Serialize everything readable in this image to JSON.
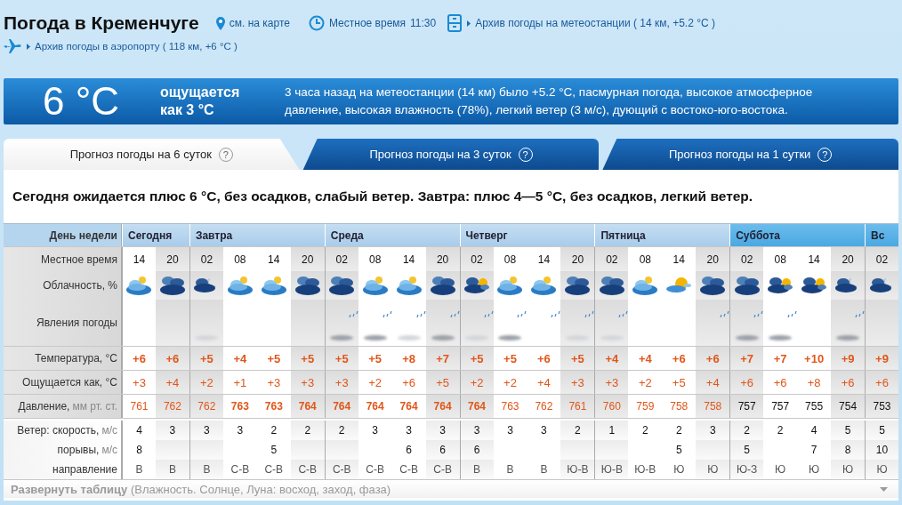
{
  "header": {
    "title": "Погода в Кременчуге",
    "map_link": "см. на карте",
    "local_time_label": "Местное время",
    "local_time": "11:30",
    "station_link": "Архив погоды на метеостанции ( 14 км, +5.2 °С )",
    "airport_link": "Архив погоды в аэропорту ( 118 км, +6 °С )"
  },
  "current": {
    "temperature": "6 °C",
    "feels_like": "ощущается как 3 °C",
    "description": "3 часа назад на метеостанции (14 км) было +5.2 °С, пасмурная погода, высокое атмосферное давление, высокая влажность (78%), легкий ветер (3 м/с), дующий с востоко-юго-востока."
  },
  "tabs": [
    {
      "label": "Прогноз погоды на 6 суток",
      "help": "?",
      "selected": true
    },
    {
      "label": "Прогноз погоды на 3 суток",
      "help": "?",
      "selected": false
    },
    {
      "label": "Прогноз погоды на 1 сутки",
      "help": "?",
      "selected": false
    }
  ],
  "summary": "Сегодня ожидается плюс 6 °С, без осадков, слабый ветер. Завтра: плюс 4—5 °С, без осадков, легкий ветер.",
  "row_labels": [
    {
      "text": "День недели"
    },
    {
      "text": "Местное время"
    },
    {
      "text": "Облачность, %"
    },
    {
      "text": "Явления погоды"
    },
    {
      "text": "Температура, °С"
    },
    {
      "text": "Ощущается как, °С"
    },
    {
      "text": "Давление,",
      "unit": "мм рт. ст."
    },
    {
      "text": "Ветер: скорость,",
      "unit": "м/с"
    },
    {
      "text": "порывы,",
      "unit": "м/с"
    },
    {
      "text": "направление"
    }
  ],
  "days": [
    {
      "name": "Сегодня",
      "weekend": false,
      "columns": [
        {
          "time": "14",
          "night": false,
          "sky": {
            "kind": "cloudy"
          },
          "temp": "+6",
          "feels": "+3",
          "pressure": {
            "text": "761",
            "kind": "elevated"
          },
          "wind": "4",
          "gusts": "8",
          "direction": "В"
        },
        {
          "time": "20",
          "night": true,
          "sky": {
            "kind": "overcast"
          },
          "temp": "+6",
          "feels": "+4",
          "pressure": {
            "text": "762",
            "kind": "elevated"
          },
          "wind": "3",
          "direction": "В"
        }
      ]
    },
    {
      "name": "Завтра",
      "weekend": false,
      "columns": [
        {
          "time": "02",
          "night": true,
          "sky": {
            "kind": "night"
          },
          "phenomena": [
            {
              "kind": "light-fog"
            }
          ],
          "temp": "+5",
          "feels": "+2",
          "pressure": {
            "text": "762",
            "kind": "elevated"
          },
          "wind": "3",
          "direction": "В"
        },
        {
          "time": "08",
          "night": false,
          "sky": {
            "kind": "cloudy"
          },
          "temp": "+4",
          "feels": "+1",
          "pressure": {
            "text": "763",
            "kind": "high"
          },
          "wind": "3",
          "direction": "С-В"
        },
        {
          "time": "14",
          "night": false,
          "sky": {
            "kind": "cloudy"
          },
          "temp": "+5",
          "feels": "+3",
          "pressure": {
            "text": "763",
            "kind": "high"
          },
          "wind": "2",
          "gusts": "5",
          "direction": "С-В"
        },
        {
          "time": "20",
          "night": true,
          "sky": {
            "kind": "overcast"
          },
          "temp": "+5",
          "feels": "+3",
          "pressure": {
            "text": "764",
            "kind": "high"
          },
          "wind": "2",
          "direction": "С-В"
        }
      ]
    },
    {
      "name": "Среда",
      "weekend": false,
      "columns": [
        {
          "time": "02",
          "night": true,
          "sky": {
            "kind": "overcast"
          },
          "phenomena": [
            {
              "kind": "rain"
            },
            {
              "kind": "fog"
            }
          ],
          "temp": "+5",
          "feels": "+3",
          "pressure": {
            "text": "764",
            "kind": "high"
          },
          "wind": "2",
          "direction": "С-В"
        },
        {
          "time": "08",
          "night": false,
          "sky": {
            "kind": "cloudy"
          },
          "phenomena": [
            {
              "kind": "rain"
            },
            {
              "kind": "fog"
            }
          ],
          "temp": "+5",
          "feels": "+2",
          "pressure": {
            "text": "764",
            "kind": "high"
          },
          "wind": "3",
          "direction": "С-В"
        },
        {
          "time": "14",
          "night": false,
          "sky": {
            "kind": "cloudy"
          },
          "phenomena": [
            {
              "kind": "rain"
            },
            {
              "kind": "light-fog"
            }
          ],
          "temp": "+8",
          "feels": "+6",
          "pressure": {
            "text": "764",
            "kind": "high"
          },
          "wind": "3",
          "gusts": "6",
          "direction": "С-В"
        },
        {
          "time": "20",
          "night": true,
          "sky": {
            "kind": "overcast"
          },
          "phenomena": [
            {
              "kind": "rain"
            },
            {
              "kind": "fog"
            }
          ],
          "temp": "+7",
          "feels": "+5",
          "pressure": {
            "text": "764",
            "kind": "high"
          },
          "wind": "3",
          "gusts": "6",
          "direction": "С-В"
        }
      ]
    },
    {
      "name": "Четверг",
      "weekend": false,
      "columns": [
        {
          "time": "02",
          "night": true,
          "sky": {
            "kind": "mixed"
          },
          "phenomena": [
            {
              "kind": "rain"
            },
            {
              "kind": "light-fog"
            }
          ],
          "temp": "+5",
          "feels": "+2",
          "pressure": {
            "text": "764",
            "kind": "high"
          },
          "wind": "3",
          "gusts": "6",
          "direction": "В"
        },
        {
          "time": "08",
          "night": false,
          "sky": {
            "kind": "cloudy"
          },
          "phenomena": [
            {
              "kind": "rain"
            },
            {
              "kind": "fog"
            }
          ],
          "temp": "+5",
          "feels": "+2",
          "pressure": {
            "text": "763",
            "kind": "elevated"
          },
          "wind": "3",
          "direction": "В"
        },
        {
          "time": "14",
          "night": false,
          "sky": {
            "kind": "cloudy"
          },
          "phenomena": [
            {
              "kind": "rain"
            }
          ],
          "temp": "+6",
          "feels": "+4",
          "pressure": {
            "text": "762",
            "kind": "elevated"
          },
          "wind": "3",
          "direction": "В"
        },
        {
          "time": "20",
          "night": true,
          "sky": {
            "kind": "overcast"
          },
          "phenomena": [
            {
              "kind": "rain"
            },
            {
              "kind": "light-fog"
            }
          ],
          "temp": "+5",
          "feels": "+3",
          "pressure": {
            "text": "761",
            "kind": "elevated"
          },
          "wind": "2",
          "direction": "Ю-В"
        }
      ]
    },
    {
      "name": "Пятница",
      "weekend": false,
      "columns": [
        {
          "time": "02",
          "night": true,
          "sky": {
            "kind": "overcast"
          },
          "phenomena": [
            {
              "kind": "rain"
            },
            {
              "kind": "light-fog"
            }
          ],
          "temp": "+4",
          "feels": "+3",
          "pressure": {
            "text": "760",
            "kind": "elevated"
          },
          "wind": "1",
          "direction": "Ю-В"
        },
        {
          "time": "08",
          "night": false,
          "sky": {
            "kind": "cloudy"
          },
          "temp": "+4",
          "feels": "+2",
          "pressure": {
            "text": "759",
            "kind": "elevated"
          },
          "wind": "2",
          "direction": "Ю-В"
        },
        {
          "time": "14",
          "night": false,
          "sky": {
            "kind": "sun"
          },
          "temp": "+6",
          "feels": "+5",
          "pressure": {
            "text": "758",
            "kind": "elevated"
          },
          "wind": "2",
          "gusts": "5",
          "direction": "Ю"
        },
        {
          "time": "20",
          "night": true,
          "sky": {
            "kind": "overcast"
          },
          "phenomena": [
            {
              "kind": "rain"
            }
          ],
          "temp": "+6",
          "feels": "+4",
          "pressure": {
            "text": "758",
            "kind": "elevated"
          },
          "wind": "3",
          "direction": "Ю"
        }
      ]
    },
    {
      "name": "Суббота",
      "weekend": true,
      "columns": [
        {
          "time": "02",
          "night": true,
          "sky": {
            "kind": "overcast"
          },
          "phenomena": [
            {
              "kind": "rain"
            },
            {
              "kind": "fog"
            }
          ],
          "temp": "+7",
          "feels": "+6",
          "pressure": {
            "text": "757",
            "kind": "normal"
          },
          "wind": "2",
          "gusts": "5",
          "direction": "Ю-З"
        },
        {
          "time": "08",
          "night": false,
          "sky": {
            "kind": "mixed"
          },
          "phenomena": [
            {
              "kind": "rain"
            },
            {
              "kind": "fog"
            }
          ],
          "temp": "+7",
          "feels": "+6",
          "pressure": {
            "text": "757",
            "kind": "normal"
          },
          "wind": "2",
          "direction": "Ю"
        },
        {
          "time": "14",
          "night": false,
          "sky": {
            "kind": "mixed"
          },
          "temp": "+10",
          "feels": "+8",
          "pressure": {
            "text": "755",
            "kind": "normal"
          },
          "wind": "4",
          "gusts": "7",
          "direction": "Ю"
        },
        {
          "time": "20",
          "night": true,
          "sky": {
            "kind": "night"
          },
          "phenomena": [
            {
              "kind": "rain"
            },
            {
              "kind": "fog"
            }
          ],
          "temp": "+9",
          "feels": "+6",
          "pressure": {
            "text": "754",
            "kind": "normal"
          },
          "wind": "5",
          "gusts": "8",
          "direction": "Ю"
        }
      ]
    },
    {
      "name": "Вс",
      "weekend": true,
      "columns": [
        {
          "time": "02",
          "night": true,
          "sky": {
            "kind": "night"
          },
          "temp": "+9",
          "feels": "+6",
          "pressure": {
            "text": "753",
            "kind": "normal"
          },
          "wind": "5",
          "gusts": "10",
          "direction": "Ю"
        }
      ]
    }
  ],
  "expand": "**Развернуть таблицу** (Влажность. Солнце, Луна: восход, заход, фаза)"
}
